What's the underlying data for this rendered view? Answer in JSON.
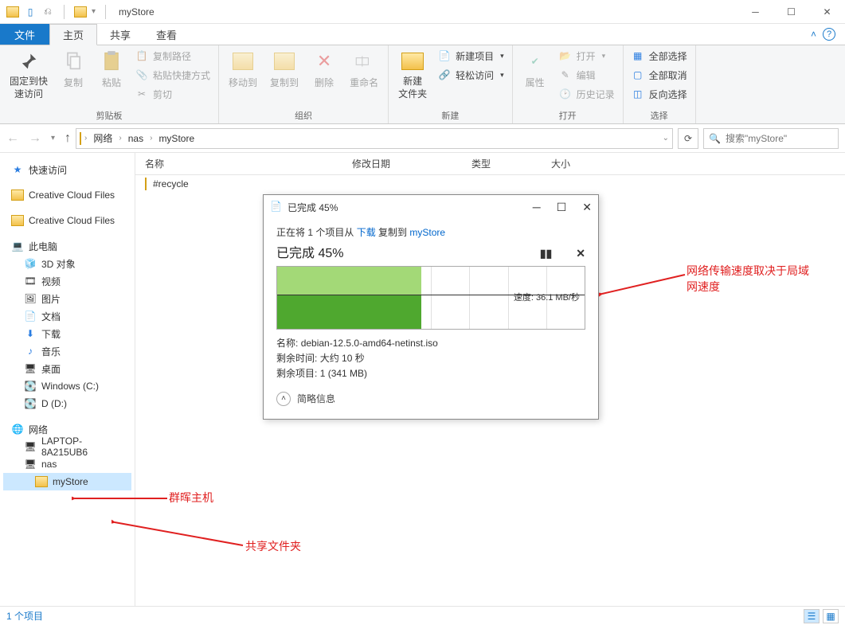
{
  "window": {
    "title": "myStore"
  },
  "ribbon": {
    "file": "文件",
    "tabs": [
      "主页",
      "共享",
      "查看"
    ],
    "groups": {
      "clipboard": {
        "label": "剪贴板",
        "pin": "固定到快\n速访问",
        "copy": "复制",
        "paste": "粘贴",
        "copy_path": "复制路径",
        "paste_shortcut": "粘贴快捷方式",
        "cut": "剪切"
      },
      "organize": {
        "label": "组织",
        "move_to": "移动到",
        "copy_to": "复制到",
        "delete": "删除",
        "rename": "重命名"
      },
      "new": {
        "label": "新建",
        "new_folder": "新建\n文件夹",
        "new_item": "新建项目",
        "easy_access": "轻松访问"
      },
      "open": {
        "label": "打开",
        "properties": "属性",
        "open": "打开",
        "edit": "编辑",
        "history": "历史记录"
      },
      "select": {
        "label": "选择",
        "select_all": "全部选择",
        "select_none": "全部取消",
        "invert": "反向选择"
      }
    }
  },
  "breadcrumb": {
    "items": [
      "网络",
      "nas",
      "myStore"
    ]
  },
  "search": {
    "placeholder": "搜索\"myStore\""
  },
  "columns": {
    "name": "名称",
    "date": "修改日期",
    "type": "类型",
    "size": "大小"
  },
  "files": [
    {
      "name": "#recycle"
    }
  ],
  "sidebar": {
    "quick_access": "快速访问",
    "ccf1": "Creative Cloud Files",
    "ccf2": "Creative Cloud Files",
    "this_pc": "此电脑",
    "pc_items": [
      "3D 对象",
      "视频",
      "图片",
      "文档",
      "下载",
      "音乐",
      "桌面",
      "Windows (C:)",
      "D (D:)"
    ],
    "network": "网络",
    "net_items": [
      "LAPTOP-8A215UB6",
      "nas",
      "myStore"
    ]
  },
  "status": {
    "item_count": "1 个项目"
  },
  "dialog": {
    "title_prefix": "已完成",
    "percent": "45%",
    "copy_line_1": "正在将 1 个项目从 ",
    "copy_src": "下载",
    "copy_mid": " 复制到 ",
    "copy_dst": "myStore",
    "progress_label": "已完成 45%",
    "speed": "速度: 36.1 MB/秒",
    "name_label": "名称:",
    "name_value": "debian-12.5.0-amd64-netinst.iso",
    "time_label": "剩余时间:",
    "time_value": "大约 10 秒",
    "remaining_label": "剩余项目:",
    "remaining_value": "1 (341 MB)",
    "more_info": "简略信息"
  },
  "annotations": {
    "speed_note": "网络传输速度取决于局域\n网速度",
    "nas_note": "群晖主机",
    "share_note": "共享文件夹"
  },
  "chart_data": {
    "type": "area",
    "title": "Transfer speed",
    "ylabel": "MB/秒",
    "ylim": [
      0,
      80
    ],
    "progress_fraction": 0.45,
    "current_speed": 36.1,
    "series": [
      {
        "name": "speed",
        "values": [
          36,
          35,
          36,
          37,
          36,
          36,
          35,
          36,
          37,
          36,
          36
        ]
      }
    ]
  }
}
